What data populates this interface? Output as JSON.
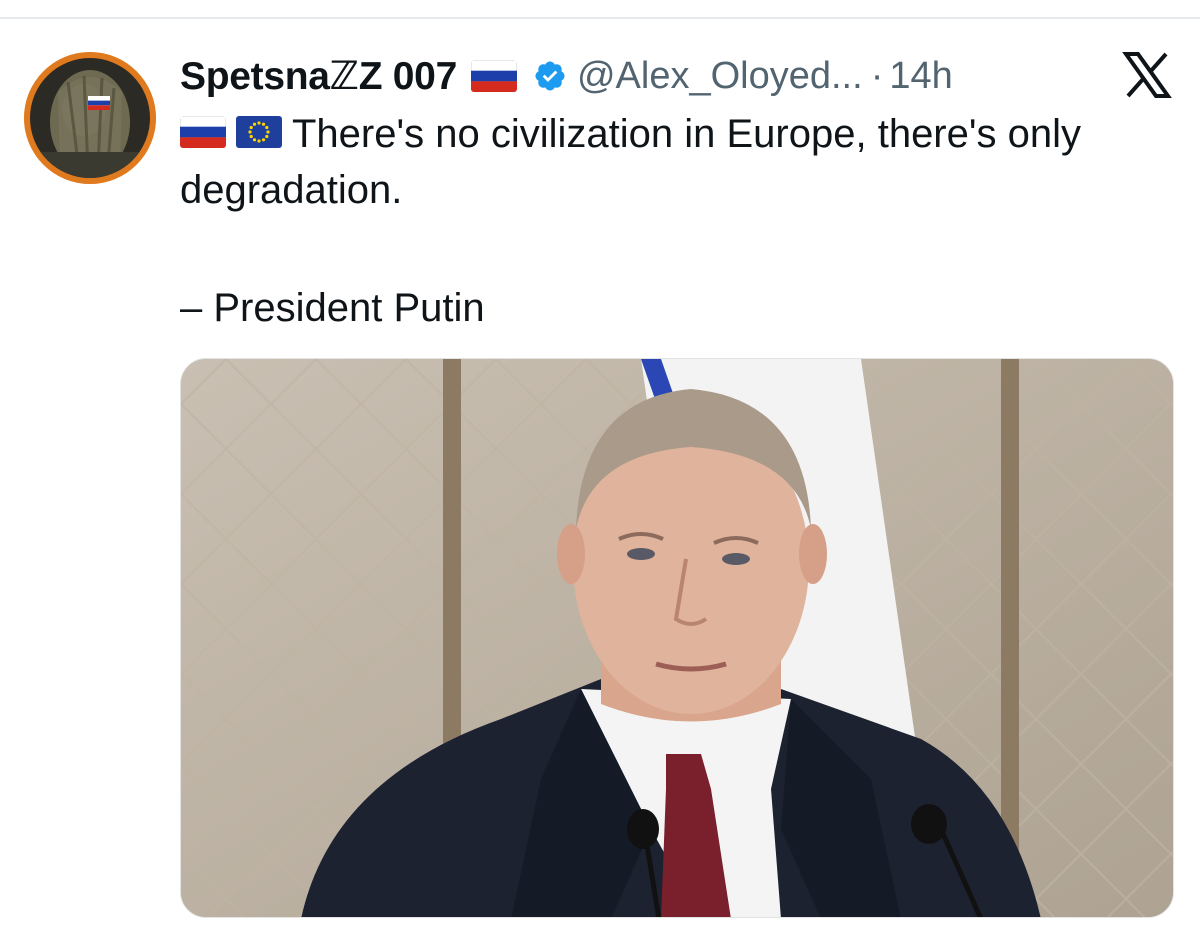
{
  "tweet": {
    "display_name": "SpetsnaℤZ 007",
    "handle": "@Alex_Oloyed...",
    "separator": "·",
    "timestamp": "14h",
    "verified": true,
    "text": "There's no civilization in Europe, there's only degradation.",
    "attribution": "– President Putin",
    "flags_in_name": [
      "russia-flag"
    ],
    "flags_in_text": [
      "russia-flag",
      "eu-flag"
    ]
  },
  "platform": {
    "logo": "x-logo"
  },
  "colors": {
    "verified_blue": "#1d9bf0",
    "secondary_text": "#536471",
    "primary_text": "#0f1419",
    "avatar_ring": "#e07a1f"
  }
}
